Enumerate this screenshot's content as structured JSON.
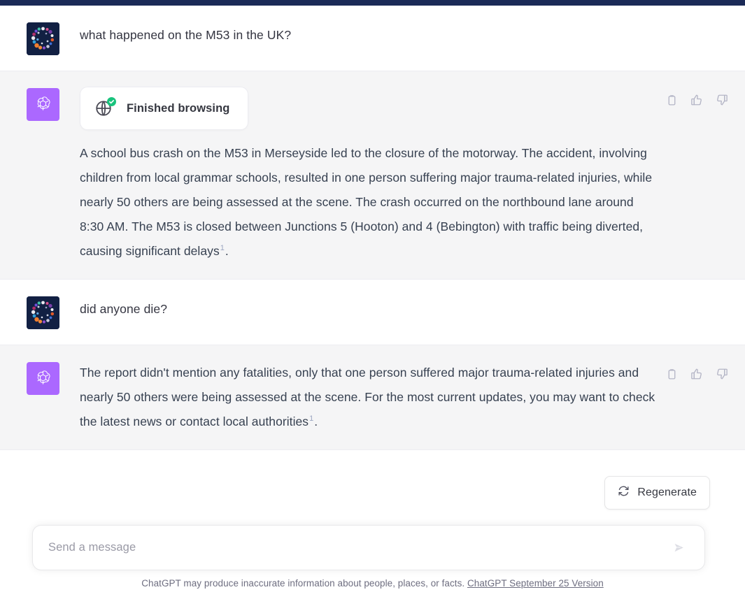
{
  "app": {
    "product_name": "ChatGPT",
    "topbar_color": "#1b2a57",
    "assistant_row_bg": "#f5f5f6",
    "assistant_avatar_color": "#ab68ff",
    "user_avatar_color": "#122043",
    "check_badge_color": "#19c37d"
  },
  "messages": [
    {
      "role": "user",
      "avatar_icon": "user-avatar-dots",
      "text": "what happened on the M53 in the UK?"
    },
    {
      "role": "assistant",
      "avatar_icon": "openai-logo",
      "tool_card": {
        "icon": "globe-icon",
        "badge_icon": "check-icon",
        "label": "Finished browsing"
      },
      "text_before_citation": "A school bus crash on the M53 in Merseyside led to the closure of the motorway. The accident, involving children from local grammar schools, resulted in one person suffering major trauma-related injuries, while nearly 50 others are being assessed at the scene. The crash occurred on the northbound lane around 8:30 AM. The M53 is closed between Junctions 5 (Hooton) and 4 (Bebington) with traffic being diverted, causing significant delays",
      "citation": "1",
      "text_after_citation": ".",
      "actions": [
        {
          "name": "copy-icon",
          "label": "Copy"
        },
        {
          "name": "thumbs-up-icon",
          "label": "Good response"
        },
        {
          "name": "thumbs-down-icon",
          "label": "Bad response"
        }
      ]
    },
    {
      "role": "user",
      "avatar_icon": "user-avatar-dots",
      "text": "did anyone die?"
    },
    {
      "role": "assistant",
      "avatar_icon": "openai-logo",
      "text_before_citation": "The report didn't mention any fatalities, only that one person suffered major trauma-related injuries and nearly 50 others were being assessed at the scene. For the most current updates, you may want to check the latest news or contact local authorities",
      "citation": "1",
      "text_after_citation": ".",
      "actions": [
        {
          "name": "copy-icon",
          "label": "Copy"
        },
        {
          "name": "thumbs-up-icon",
          "label": "Good response"
        },
        {
          "name": "thumbs-down-icon",
          "label": "Bad response"
        }
      ]
    }
  ],
  "regenerate": {
    "icon": "refresh-icon",
    "label": "Regenerate"
  },
  "composer": {
    "placeholder": "Send a message",
    "value": "",
    "send_icon": "send-arrow-icon"
  },
  "footer": {
    "disclaimer": "ChatGPT may produce inaccurate information about people, places, or facts.",
    "version_link": "ChatGPT September 25 Version"
  }
}
